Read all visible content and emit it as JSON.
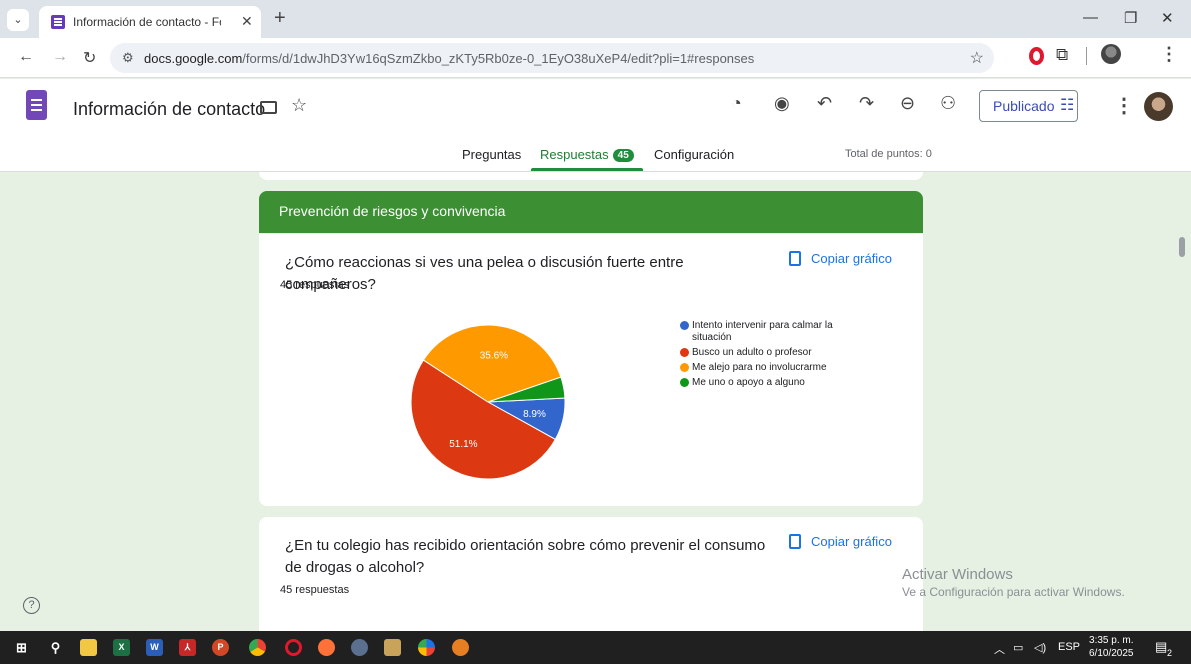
{
  "browser": {
    "tab_title": "Información de contacto - Form",
    "url_host": "docs.google.com",
    "url_path": "/forms/d/1dwJhD3Yw16qSzmZkbo_zKTy5Rb0ze-0_1EyO38uXeP4/edit?pli=1#responses"
  },
  "header": {
    "doc_title": "Información de contacto",
    "publish_label": "Publicado",
    "tabs": [
      {
        "label": "Preguntas"
      },
      {
        "label": "Respuestas",
        "count": "45"
      },
      {
        "label": "Configuración"
      }
    ],
    "total_points": "Total de puntos: 0"
  },
  "section": {
    "title": "Prevención de riesgos y convivencia"
  },
  "questions": [
    {
      "title": "¿Cómo reaccionas si ves una pelea o discusión fuerte entre compañeros?",
      "responses": "45 respuestas",
      "copy_label": "Copiar gráfico"
    },
    {
      "title": "¿En tu colegio has recibido orientación sobre cómo prevenir el consumo de drogas o alcohol?",
      "responses": "45 respuestas",
      "copy_label": "Copiar gráfico"
    }
  ],
  "chart_data": {
    "type": "pie",
    "title": "",
    "series": [
      {
        "name": "Intento intervenir para calmar la situación",
        "value": 8.9,
        "label": "8.9%",
        "color": "#3366cc"
      },
      {
        "name": "Busco un adulto o profesor",
        "value": 51.1,
        "label": "51.1%",
        "color": "#dc3912"
      },
      {
        "name": "Me alejo para no involucrarme",
        "value": 35.6,
        "label": "35.6%",
        "color": "#ff9900"
      },
      {
        "name": "Me uno o apoyo a alguno",
        "value": 4.4,
        "label": "",
        "color": "#109618"
      }
    ],
    "legend": "right"
  },
  "watermark": {
    "title": "Activar Windows",
    "subtitle": "Ve a Configuración para activar Windows."
  },
  "taskbar": {
    "language": "ESP",
    "time": "3:35 p. m.",
    "date": "6/10/2025",
    "notifications": "2"
  }
}
